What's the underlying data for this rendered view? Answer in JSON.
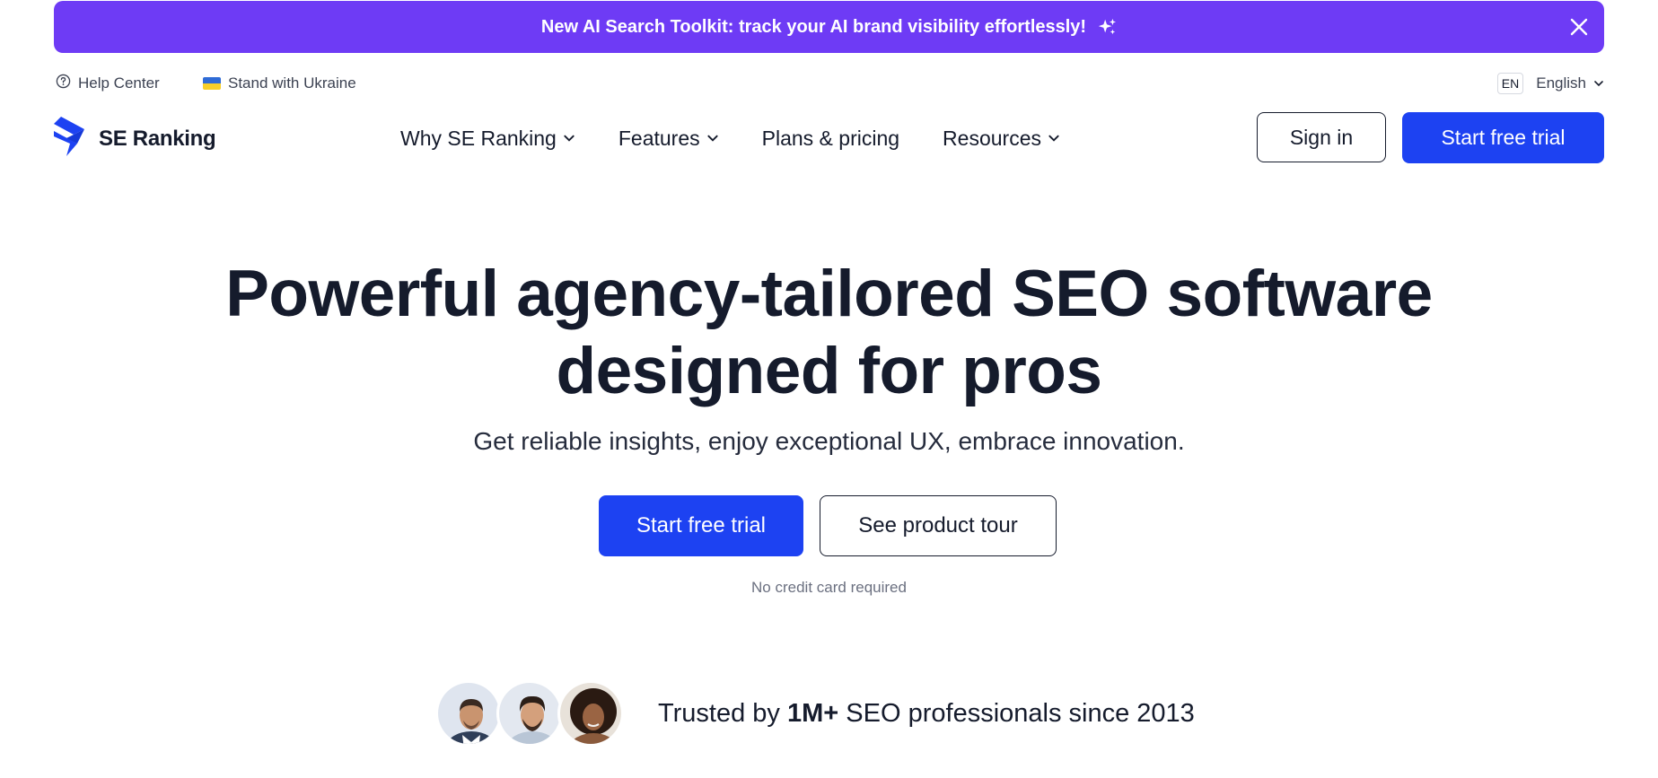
{
  "banner": {
    "text": "New AI Search Toolkit: track your AI brand visibility effortlessly!",
    "background": "#6e3bf5",
    "icons": [
      "sparkle-icon",
      "close-icon"
    ]
  },
  "util": {
    "help_label": "Help Center",
    "ukraine_label": "Stand with Ukraine",
    "lang_code": "EN",
    "lang_label": "English"
  },
  "header": {
    "logo_text": "SE Ranking",
    "nav": [
      {
        "label": "Why SE Ranking",
        "dropdown": true
      },
      {
        "label": "Features",
        "dropdown": true
      },
      {
        "label": "Plans & pricing",
        "dropdown": false
      },
      {
        "label": "Resources",
        "dropdown": true
      }
    ],
    "signin_label": "Sign in",
    "trial_label": "Start free trial"
  },
  "hero": {
    "title_line1": "Powerful agency-tailored SEO software",
    "title_line2": "designed for pros",
    "subtitle": "Get reliable insights, enjoy exceptional UX, embrace innovation.",
    "primary_cta": "Start free trial",
    "secondary_cta": "See product tour",
    "note": "No credit card required"
  },
  "trust": {
    "prefix": "Trusted by",
    "highlight": "1M+",
    "suffix": "SEO professionals since 2013"
  },
  "colors": {
    "brand_blue": "#1d42f2",
    "text_dark": "#151b2c",
    "banner_purple": "#6e3bf5"
  }
}
